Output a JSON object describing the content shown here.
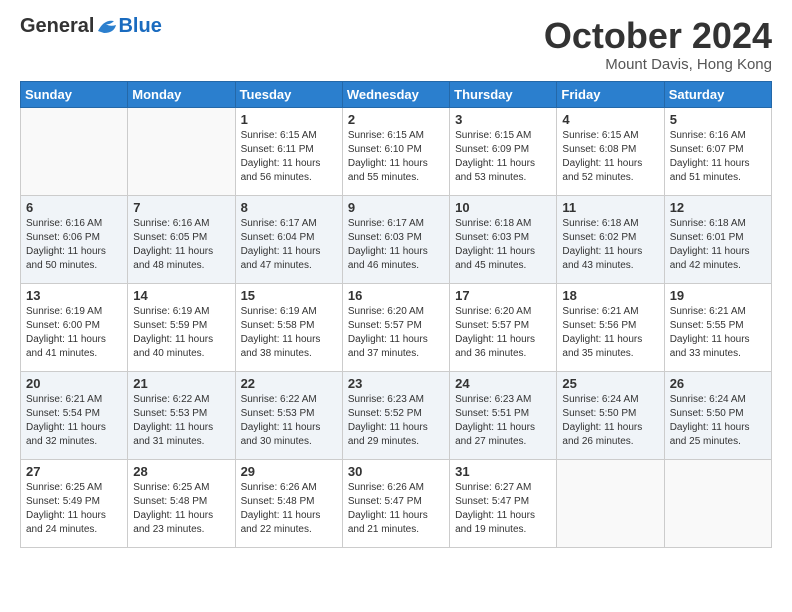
{
  "logo": {
    "general": "General",
    "blue": "Blue"
  },
  "title": "October 2024",
  "location": "Mount Davis, Hong Kong",
  "days_of_week": [
    "Sunday",
    "Monday",
    "Tuesday",
    "Wednesday",
    "Thursday",
    "Friday",
    "Saturday"
  ],
  "weeks": [
    [
      {
        "day": "",
        "sunrise": "",
        "sunset": "",
        "daylight": ""
      },
      {
        "day": "",
        "sunrise": "",
        "sunset": "",
        "daylight": ""
      },
      {
        "day": "1",
        "sunrise": "Sunrise: 6:15 AM",
        "sunset": "Sunset: 6:11 PM",
        "daylight": "Daylight: 11 hours and 56 minutes."
      },
      {
        "day": "2",
        "sunrise": "Sunrise: 6:15 AM",
        "sunset": "Sunset: 6:10 PM",
        "daylight": "Daylight: 11 hours and 55 minutes."
      },
      {
        "day": "3",
        "sunrise": "Sunrise: 6:15 AM",
        "sunset": "Sunset: 6:09 PM",
        "daylight": "Daylight: 11 hours and 53 minutes."
      },
      {
        "day": "4",
        "sunrise": "Sunrise: 6:15 AM",
        "sunset": "Sunset: 6:08 PM",
        "daylight": "Daylight: 11 hours and 52 minutes."
      },
      {
        "day": "5",
        "sunrise": "Sunrise: 6:16 AM",
        "sunset": "Sunset: 6:07 PM",
        "daylight": "Daylight: 11 hours and 51 minutes."
      }
    ],
    [
      {
        "day": "6",
        "sunrise": "Sunrise: 6:16 AM",
        "sunset": "Sunset: 6:06 PM",
        "daylight": "Daylight: 11 hours and 50 minutes."
      },
      {
        "day": "7",
        "sunrise": "Sunrise: 6:16 AM",
        "sunset": "Sunset: 6:05 PM",
        "daylight": "Daylight: 11 hours and 48 minutes."
      },
      {
        "day": "8",
        "sunrise": "Sunrise: 6:17 AM",
        "sunset": "Sunset: 6:04 PM",
        "daylight": "Daylight: 11 hours and 47 minutes."
      },
      {
        "day": "9",
        "sunrise": "Sunrise: 6:17 AM",
        "sunset": "Sunset: 6:03 PM",
        "daylight": "Daylight: 11 hours and 46 minutes."
      },
      {
        "day": "10",
        "sunrise": "Sunrise: 6:18 AM",
        "sunset": "Sunset: 6:03 PM",
        "daylight": "Daylight: 11 hours and 45 minutes."
      },
      {
        "day": "11",
        "sunrise": "Sunrise: 6:18 AM",
        "sunset": "Sunset: 6:02 PM",
        "daylight": "Daylight: 11 hours and 43 minutes."
      },
      {
        "day": "12",
        "sunrise": "Sunrise: 6:18 AM",
        "sunset": "Sunset: 6:01 PM",
        "daylight": "Daylight: 11 hours and 42 minutes."
      }
    ],
    [
      {
        "day": "13",
        "sunrise": "Sunrise: 6:19 AM",
        "sunset": "Sunset: 6:00 PM",
        "daylight": "Daylight: 11 hours and 41 minutes."
      },
      {
        "day": "14",
        "sunrise": "Sunrise: 6:19 AM",
        "sunset": "Sunset: 5:59 PM",
        "daylight": "Daylight: 11 hours and 40 minutes."
      },
      {
        "day": "15",
        "sunrise": "Sunrise: 6:19 AM",
        "sunset": "Sunset: 5:58 PM",
        "daylight": "Daylight: 11 hours and 38 minutes."
      },
      {
        "day": "16",
        "sunrise": "Sunrise: 6:20 AM",
        "sunset": "Sunset: 5:57 PM",
        "daylight": "Daylight: 11 hours and 37 minutes."
      },
      {
        "day": "17",
        "sunrise": "Sunrise: 6:20 AM",
        "sunset": "Sunset: 5:57 PM",
        "daylight": "Daylight: 11 hours and 36 minutes."
      },
      {
        "day": "18",
        "sunrise": "Sunrise: 6:21 AM",
        "sunset": "Sunset: 5:56 PM",
        "daylight": "Daylight: 11 hours and 35 minutes."
      },
      {
        "day": "19",
        "sunrise": "Sunrise: 6:21 AM",
        "sunset": "Sunset: 5:55 PM",
        "daylight": "Daylight: 11 hours and 33 minutes."
      }
    ],
    [
      {
        "day": "20",
        "sunrise": "Sunrise: 6:21 AM",
        "sunset": "Sunset: 5:54 PM",
        "daylight": "Daylight: 11 hours and 32 minutes."
      },
      {
        "day": "21",
        "sunrise": "Sunrise: 6:22 AM",
        "sunset": "Sunset: 5:53 PM",
        "daylight": "Daylight: 11 hours and 31 minutes."
      },
      {
        "day": "22",
        "sunrise": "Sunrise: 6:22 AM",
        "sunset": "Sunset: 5:53 PM",
        "daylight": "Daylight: 11 hours and 30 minutes."
      },
      {
        "day": "23",
        "sunrise": "Sunrise: 6:23 AM",
        "sunset": "Sunset: 5:52 PM",
        "daylight": "Daylight: 11 hours and 29 minutes."
      },
      {
        "day": "24",
        "sunrise": "Sunrise: 6:23 AM",
        "sunset": "Sunset: 5:51 PM",
        "daylight": "Daylight: 11 hours and 27 minutes."
      },
      {
        "day": "25",
        "sunrise": "Sunrise: 6:24 AM",
        "sunset": "Sunset: 5:50 PM",
        "daylight": "Daylight: 11 hours and 26 minutes."
      },
      {
        "day": "26",
        "sunrise": "Sunrise: 6:24 AM",
        "sunset": "Sunset: 5:50 PM",
        "daylight": "Daylight: 11 hours and 25 minutes."
      }
    ],
    [
      {
        "day": "27",
        "sunrise": "Sunrise: 6:25 AM",
        "sunset": "Sunset: 5:49 PM",
        "daylight": "Daylight: 11 hours and 24 minutes."
      },
      {
        "day": "28",
        "sunrise": "Sunrise: 6:25 AM",
        "sunset": "Sunset: 5:48 PM",
        "daylight": "Daylight: 11 hours and 23 minutes."
      },
      {
        "day": "29",
        "sunrise": "Sunrise: 6:26 AM",
        "sunset": "Sunset: 5:48 PM",
        "daylight": "Daylight: 11 hours and 22 minutes."
      },
      {
        "day": "30",
        "sunrise": "Sunrise: 6:26 AM",
        "sunset": "Sunset: 5:47 PM",
        "daylight": "Daylight: 11 hours and 21 minutes."
      },
      {
        "day": "31",
        "sunrise": "Sunrise: 6:27 AM",
        "sunset": "Sunset: 5:47 PM",
        "daylight": "Daylight: 11 hours and 19 minutes."
      },
      {
        "day": "",
        "sunrise": "",
        "sunset": "",
        "daylight": ""
      },
      {
        "day": "",
        "sunrise": "",
        "sunset": "",
        "daylight": ""
      }
    ]
  ]
}
